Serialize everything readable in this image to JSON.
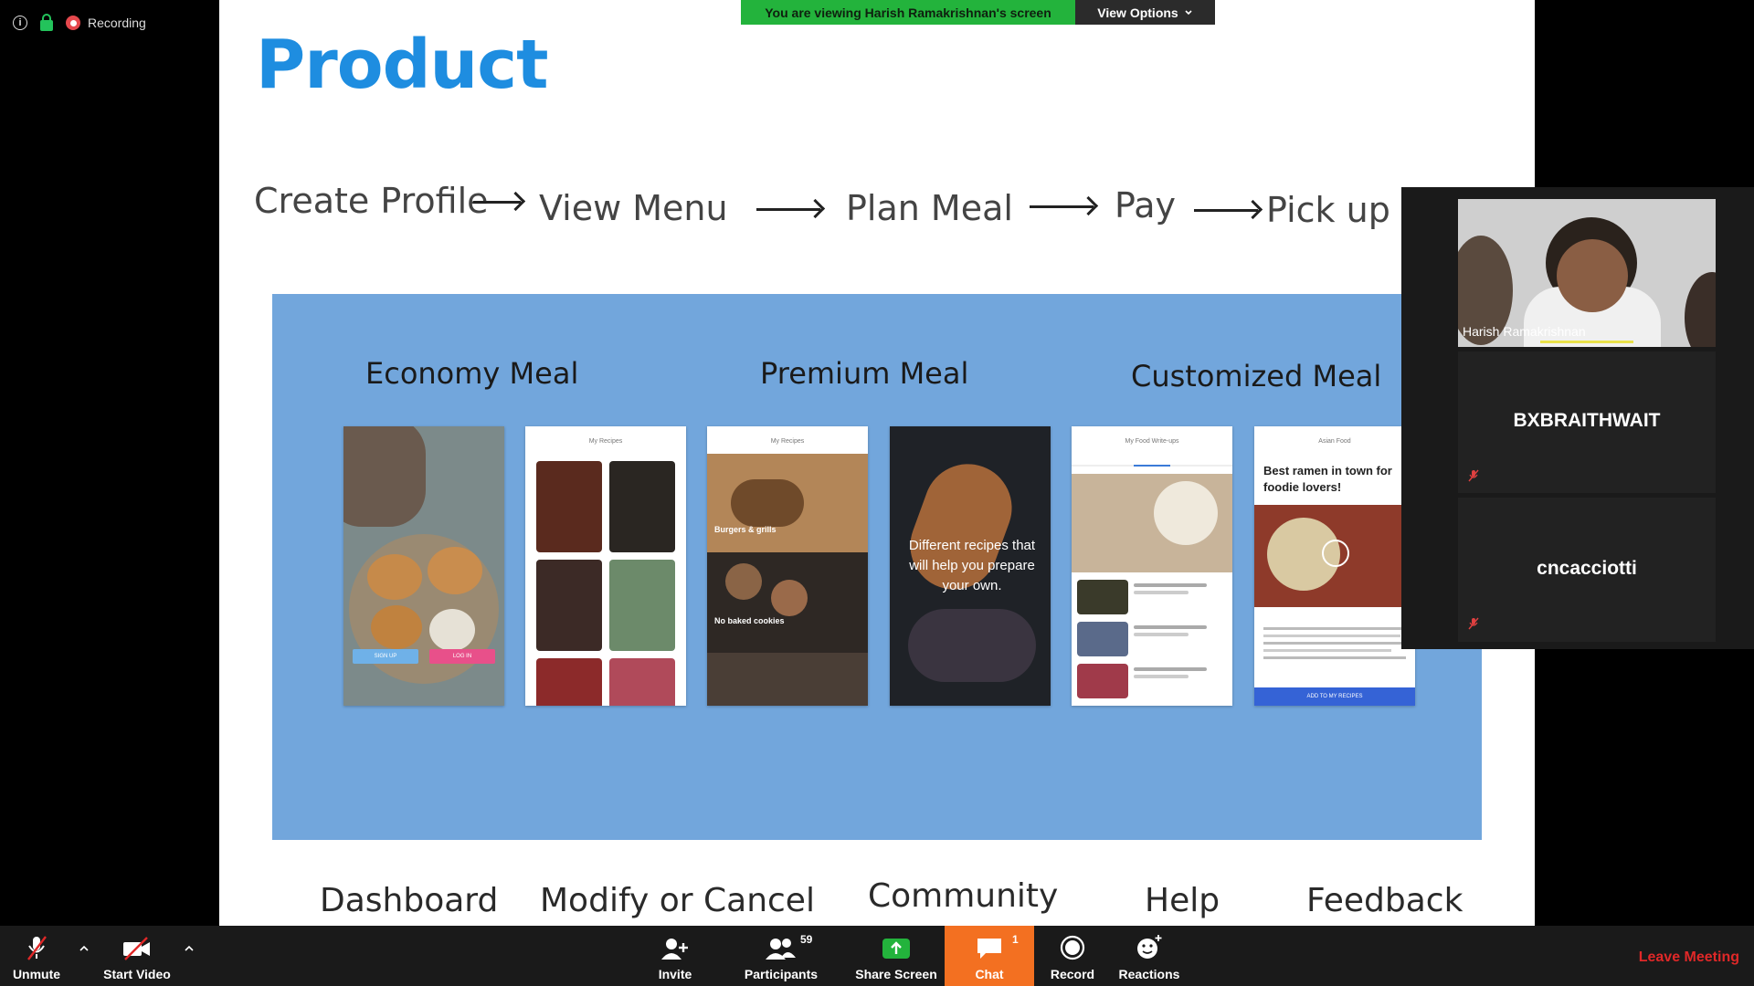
{
  "status": {
    "recording_label": "Recording"
  },
  "banner": {
    "viewing_text": "You are viewing Harish Ramakrishnan's screen",
    "view_options_label": "View Options"
  },
  "slide": {
    "title": "Product",
    "flow_steps": [
      "Create Profile",
      "View Menu",
      "Plan Meal",
      "Pay",
      "Pick up /"
    ],
    "meal_headings": [
      "Economy Meal",
      "Premium Meal",
      "Customized Meal"
    ],
    "phone_texts": {
      "baked": "No baked cookies",
      "burgers": "Burgers & grills",
      "recipes": "Different recipes that will help you prepare your own.",
      "ramen": "Best ramen in town for foodie lovers!",
      "add_to_recipes": "ADD TO MY RECIPES",
      "sign_up": "SIGN UP",
      "log_in": "LOG IN",
      "my_recipes": "My Recipes",
      "my_food": "My Food Write-ups",
      "asian_food": "Asian Food"
    },
    "bottom_nav": [
      "Dashboard",
      "Modify or Cancel",
      "Community",
      "Help",
      "Feedback"
    ]
  },
  "participants_panel": {
    "video_name": "Harish Ramakrishnan",
    "tiles": [
      {
        "name": "BXBRAITHWAIT"
      },
      {
        "name": "cncacciotti"
      }
    ]
  },
  "toolbar": {
    "unmute": "Unmute",
    "start_video": "Start Video",
    "invite": "Invite",
    "participants": "Participants",
    "participants_count": "59",
    "share_screen": "Share Screen",
    "chat": "Chat",
    "chat_badge": "1",
    "record": "Record",
    "reactions": "Reactions",
    "leave": "Leave Meeting"
  },
  "colors": {
    "accent_green": "#23b33c",
    "chat_orange": "#f37021",
    "leave_red": "#e02828",
    "slide_blue": "#72a6dc",
    "title_blue": "#1e8de0"
  }
}
